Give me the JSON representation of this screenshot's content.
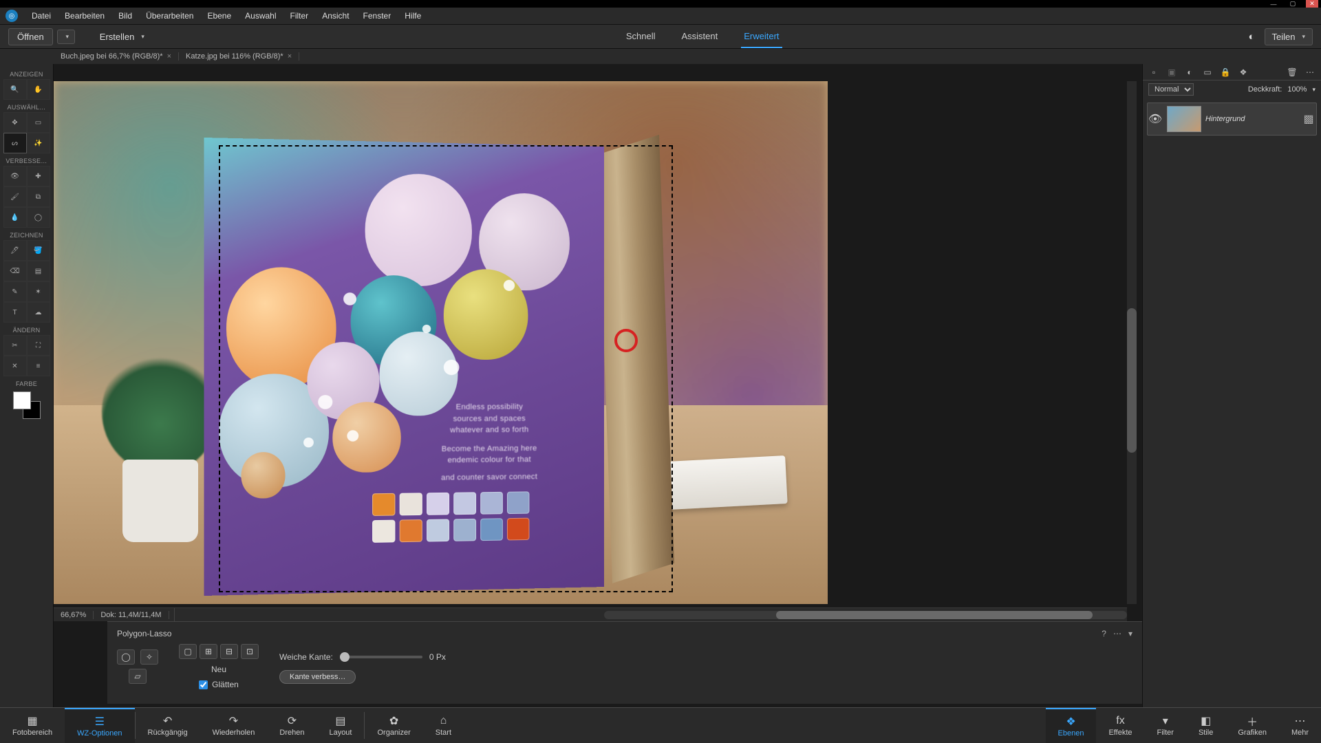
{
  "menubar": {
    "items": [
      "Datei",
      "Bearbeiten",
      "Bild",
      "Überarbeiten",
      "Ebene",
      "Auswahl",
      "Filter",
      "Ansicht",
      "Fenster",
      "Hilfe"
    ]
  },
  "optbar": {
    "open": "Öffnen",
    "create": "Erstellen",
    "modes": {
      "quick": "Schnell",
      "guided": "Assistent",
      "expert": "Erweitert"
    },
    "share": "Teilen"
  },
  "doctabs": [
    {
      "label": "Buch.jpeg bei 66,7% (RGB/8)*"
    },
    {
      "label": "Katze.jpg bei 116% (RGB/8)*"
    }
  ],
  "toolbar": {
    "view": "ANZEIGEN",
    "select": "AUSWÄHL…",
    "enhance": "VERBESSE…",
    "draw": "ZEICHNEN",
    "modify": "ÄNDERN",
    "color": "FARBE"
  },
  "status": {
    "zoom": "66,67%",
    "doc": "Dok: 11,4M/11,4M"
  },
  "toolopts": {
    "toolname": "Polygon-Lasso",
    "new": "Neu",
    "featherLabel": "Weiche Kante:",
    "featherValue": "0 Px",
    "antialias": "Glätten",
    "refine": "Kante verbess…"
  },
  "layers": {
    "blendMode": "Normal",
    "opacityLabel": "Deckkraft:",
    "opacityValue": "100%",
    "layer0": "Hintergrund"
  },
  "taskbar": {
    "left": [
      "Fotobereich",
      "WZ-Optionen",
      "Rückgängig",
      "Wiederholen",
      "Drehen",
      "Layout",
      "Organizer",
      "Start"
    ],
    "right": [
      "Ebenen",
      "Effekte",
      "Filter",
      "Stile",
      "Grafiken",
      "Mehr"
    ]
  },
  "book": {
    "line1": "Endless possibility",
    "line2": "sources and spaces",
    "line3": "whatever and so forth",
    "line4": "Become the Amazing here",
    "line5": "endemic colour for that",
    "line6": "and counter savor connect"
  }
}
